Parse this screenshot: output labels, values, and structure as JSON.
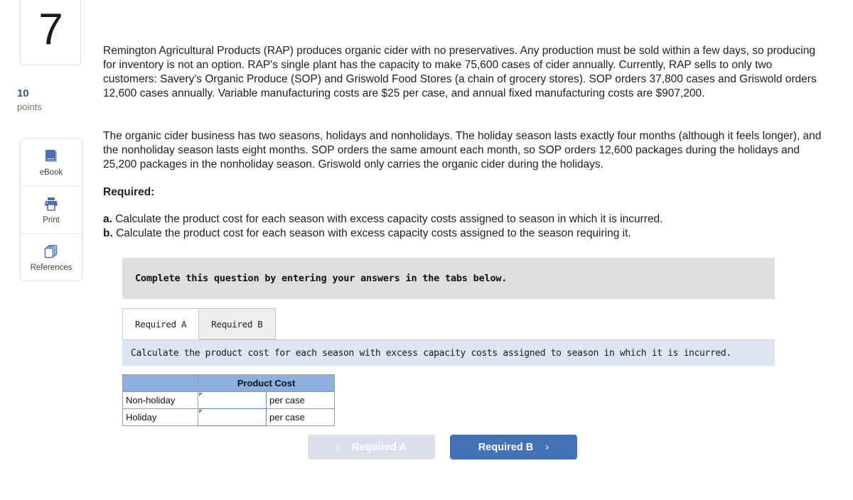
{
  "sidebar": {
    "question_number": "7",
    "points_value": "10",
    "points_label": "points",
    "tools": [
      {
        "label": "eBook",
        "icon": "book-icon"
      },
      {
        "label": "Print",
        "icon": "printer-icon"
      },
      {
        "label": "References",
        "icon": "references-icon"
      }
    ]
  },
  "question": {
    "paragraph1": "Remington Agricultural Products (RAP) produces organic cider with no preservatives. Any production must be sold within a few days, so producing for inventory is not an option. RAP's single plant has the capacity to make 75,600 cases of cider annually. Currently, RAP sells to only two customers: Savery's Organic Produce (SOP) and Griswold Food Stores (a chain of grocery stores). SOP orders 37,800 cases and Griswold orders 12,600 cases annually. Variable manufacturing costs are $25 per case, and annual fixed manufacturing costs are $907,200.",
    "paragraph2": "The organic cider business has two seasons, holidays and nonholidays. The holiday season lasts exactly four months (although it feels longer), and the nonholiday season lasts eight months. SOP orders the same amount each month, so SOP orders 12,600 packages during the holidays and 25,200 packages in the nonholiday season. Griswold only carries the organic cider during the holidays.",
    "required_heading": "Required:",
    "required_items": [
      {
        "marker": "a.",
        "text": "Calculate the product cost for each season with excess capacity costs assigned to season in which it is incurred."
      },
      {
        "marker": "b.",
        "text": "Calculate the product cost for each season with excess capacity costs assigned to the season requiring it."
      }
    ]
  },
  "widget": {
    "banner": "Complete this question by entering your answers in the tabs below.",
    "tabs": [
      {
        "label": "Required A",
        "active": true
      },
      {
        "label": "Required B",
        "active": false
      }
    ],
    "instruction": "Calculate the product cost for each season with excess capacity costs assigned to season in which it is incurred.",
    "table": {
      "headers": [
        "",
        "Product Cost"
      ],
      "rows": [
        {
          "label": "Non-holiday",
          "value": "",
          "unit": "per case"
        },
        {
          "label": "Holiday",
          "value": "",
          "unit": "per case"
        }
      ]
    },
    "nav": {
      "prev_label": "Required A",
      "prev_icon": "chevron-left-icon",
      "next_label": "Required B",
      "next_icon": "chevron-right-icon"
    }
  },
  "colors": {
    "accent_blue": "#4472b8",
    "table_header_blue": "#8cb0e0",
    "instruction_blue": "#dce6f5",
    "banner_gray": "#dedede",
    "icon_blue": "#4a6fb5",
    "points_blue": "#2f5596"
  }
}
